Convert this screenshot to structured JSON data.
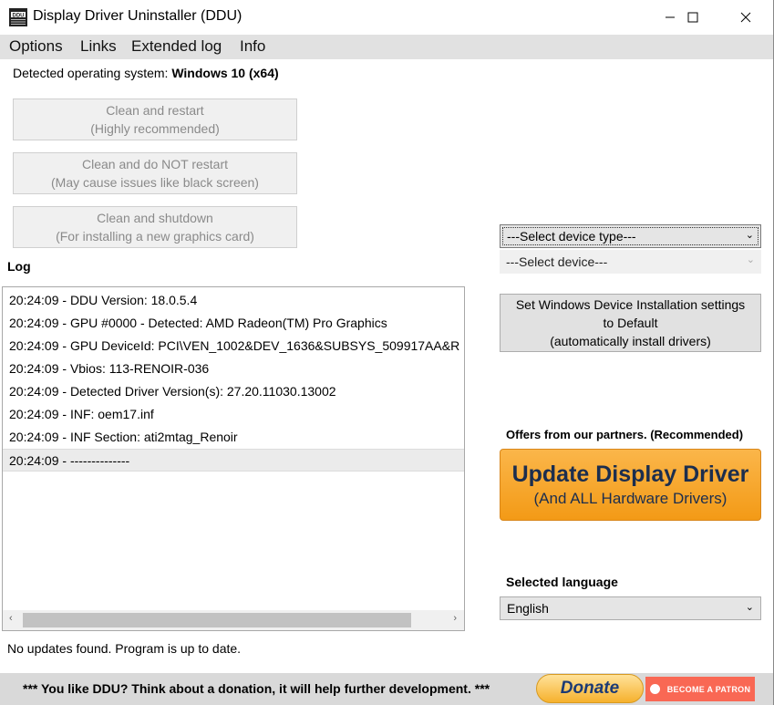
{
  "window": {
    "title": "Display Driver Uninstaller (DDU)",
    "icon": "ddu-logo-icon",
    "controls": [
      "minimize-icon",
      "maximize-icon",
      "close-icon"
    ]
  },
  "menu": {
    "items": [
      "Options",
      "Links",
      "Extended log",
      "Info"
    ]
  },
  "os": {
    "label": "Detected operating system: ",
    "value": "Windows 10 (x64)"
  },
  "actions": [
    {
      "line1": "Clean and restart",
      "line2": "(Highly recommended)"
    },
    {
      "line1": "Clean and do NOT restart",
      "line2": "(May cause issues like black screen)"
    },
    {
      "line1": "Clean and shutdown",
      "line2": "(For installing a new graphics card)"
    }
  ],
  "log": {
    "label": "Log",
    "entries": [
      "20:24:09 - DDU Version: 18.0.5.4",
      "20:24:09 - GPU #0000 - Detected: AMD Radeon(TM) Pro Graphics",
      "20:24:09 - GPU DeviceId: PCI\\VEN_1002&DEV_1636&SUBSYS_509917AA&R",
      "20:24:09 - Vbios: 113-RENOIR-036",
      "20:24:09 - Detected Driver Version(s): 27.20.11030.13002",
      "20:24:09 - INF: oem17.inf",
      "20:24:09 - INF Section: ati2mtag_Renoir",
      "20:24:09 - --------------"
    ],
    "selected_index": 7
  },
  "status": "No updates found. Program is up to date.",
  "device_type_select": {
    "value": "---Select device type---"
  },
  "device_select": {
    "value": "---Select device---"
  },
  "set_windows_button": {
    "line1": "Set Windows Device Installation settings",
    "line2": "to Default",
    "line3": "(automatically install drivers)"
  },
  "offers": {
    "label": "Offers from our partners. (Recommended)",
    "title": "Update Display Driver",
    "subtitle": "(And ALL Hardware Drivers)"
  },
  "language": {
    "label": "Selected language",
    "value": "English"
  },
  "footer": {
    "text": "*** You like DDU? Think about a donation, it will help further development. ***",
    "donate_label": "Donate",
    "patron_label": "BECOME A PATRON"
  },
  "colors": {
    "menu_bg": "#e1e1e1",
    "update_orange": "#f39a16",
    "patreon": "#f96854"
  }
}
